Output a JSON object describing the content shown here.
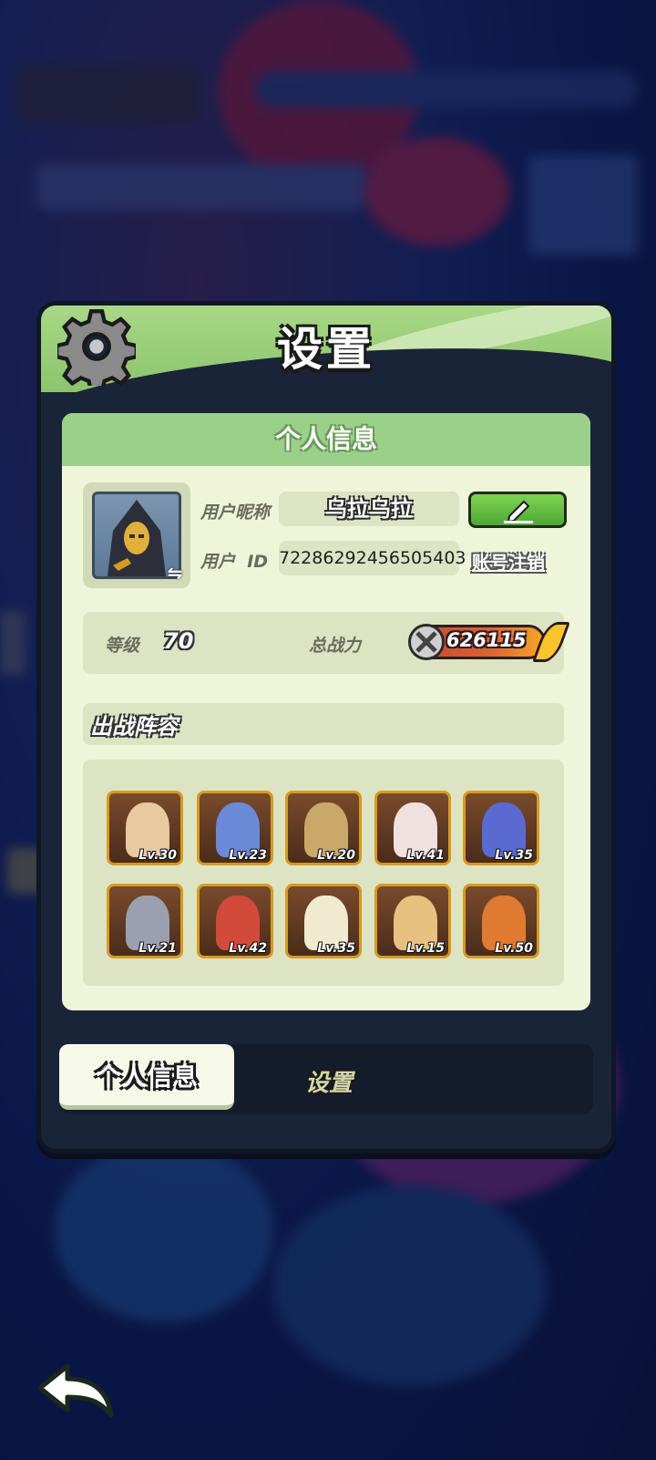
{
  "dialog": {
    "title": "设置",
    "section_title": "个人信息"
  },
  "profile": {
    "nickname_label": "用户昵称",
    "nickname": "乌拉乌拉",
    "id_label": "用户  ID",
    "user_id": "72286292456505403",
    "logout_link": "账号注销"
  },
  "stats": {
    "level_label": "等级",
    "level": "70",
    "power_label": "总战力",
    "power": "626115"
  },
  "lineup": {
    "title": "出战阵容",
    "heroes": [
      {
        "level": "Lv.30",
        "color": "#e8c9a0"
      },
      {
        "level": "Lv.23",
        "color": "#6a8ad8"
      },
      {
        "level": "Lv.20",
        "color": "#c9a86a"
      },
      {
        "level": "Lv.41",
        "color": "#f0e0e0"
      },
      {
        "level": "Lv.35",
        "color": "#5a6ad0"
      },
      {
        "level": "Lv.21",
        "color": "#9aa0b0"
      },
      {
        "level": "Lv.42",
        "color": "#d24a3a"
      },
      {
        "level": "Lv.35",
        "color": "#f0ead0"
      },
      {
        "level": "Lv.15",
        "color": "#e8c080"
      },
      {
        "level": "Lv.50",
        "color": "#e07a30"
      }
    ]
  },
  "tabs": {
    "active": "个人信息",
    "inactive": "设置"
  },
  "colors": {
    "header_green": "#9bd08a",
    "card_bg": "#eef5d9",
    "panel_bg": "#1a2438",
    "hero_border": "#d89a1c"
  }
}
